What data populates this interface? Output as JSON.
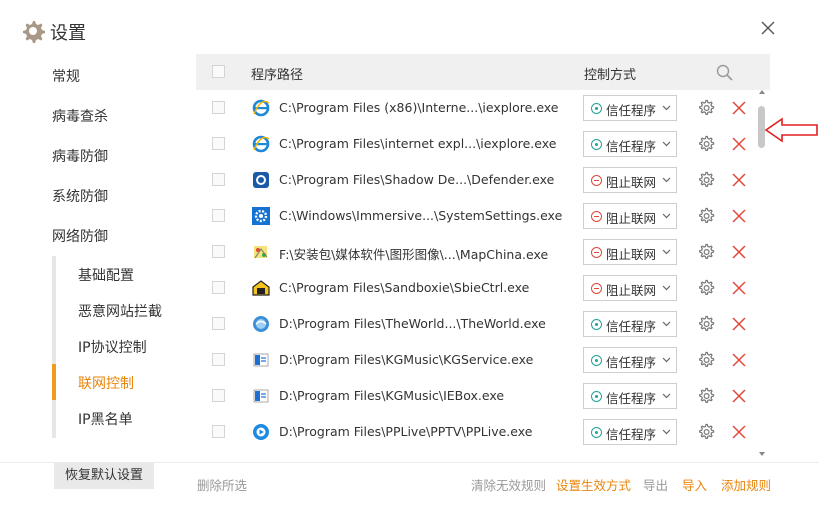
{
  "window": {
    "title": "设置",
    "close_icon": "close-icon"
  },
  "sidebar": {
    "items": [
      {
        "label": "常规"
      },
      {
        "label": "病毒查杀"
      },
      {
        "label": "病毒防御"
      },
      {
        "label": "系统防御"
      },
      {
        "label": "网络防御"
      }
    ],
    "sub_items": [
      {
        "label": "基础配置"
      },
      {
        "label": "恶意网站拦截"
      },
      {
        "label": "IP协议控制"
      },
      {
        "label": "联网控制",
        "active": true
      },
      {
        "label": "IP黑名单"
      }
    ],
    "restore_label": "恢复默认设置"
  },
  "table": {
    "col_path": "程序路径",
    "col_mode": "控制方式",
    "rows": [
      {
        "icon": "ie-icon",
        "path": "C:\\Program Files (x86)\\Interne...\\iexplore.exe",
        "mode": "信任程序",
        "mode_type": "trust"
      },
      {
        "icon": "ie-icon",
        "path": "C:\\Program Files\\internet expl...\\iexplore.exe",
        "mode": "信任程序",
        "mode_type": "trust"
      },
      {
        "icon": "defender-icon",
        "path": "C:\\Program Files\\Shadow De...\\Defender.exe",
        "mode": "阻止联网",
        "mode_type": "block"
      },
      {
        "icon": "settings-app-icon",
        "path": "C:\\Windows\\Immersive...\\SystemSettings.exe",
        "mode": "阻止联网",
        "mode_type": "block"
      },
      {
        "icon": "mapchina-icon",
        "path": "F:\\安装包\\媒体软件\\图形图像\\...\\MapChina.exe",
        "mode": "阻止联网",
        "mode_type": "block"
      },
      {
        "icon": "sandboxie-icon",
        "path": "C:\\Program Files\\Sandboxie\\SbieCtrl.exe",
        "mode": "阻止联网",
        "mode_type": "block"
      },
      {
        "icon": "theworld-icon",
        "path": "D:\\Program Files\\TheWorld...\\TheWorld.exe",
        "mode": "信任程序",
        "mode_type": "trust"
      },
      {
        "icon": "kgmusic-icon",
        "path": "D:\\Program Files\\KGMusic\\KGService.exe",
        "mode": "信任程序",
        "mode_type": "trust"
      },
      {
        "icon": "kgmusic-icon",
        "path": "D:\\Program Files\\KGMusic\\IEBox.exe",
        "mode": "信任程序",
        "mode_type": "trust"
      },
      {
        "icon": "pptv-icon",
        "path": "D:\\Program Files\\PPLive\\PPTV\\PPLive.exe",
        "mode": "信任程序",
        "mode_type": "trust"
      }
    ]
  },
  "footer": {
    "delete_selected": "删除所选",
    "clear_invalid": "清除无效规则",
    "set_mode": "设置生效方式",
    "export": "导出",
    "import": "导入",
    "add_rule": "添加规则"
  },
  "colors": {
    "accent": "#e8860c",
    "trust": "#22a39a",
    "block": "#e0483a",
    "delete": "#e0483a",
    "annotation_arrow": "#e02020"
  }
}
